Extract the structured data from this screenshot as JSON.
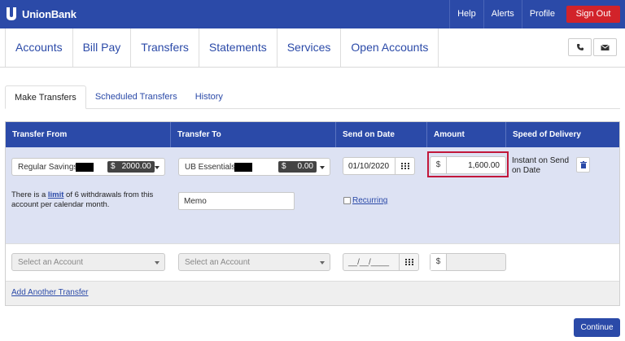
{
  "brand": {
    "name": "UnionBank"
  },
  "topnav": {
    "help": "Help",
    "alerts": "Alerts",
    "profile": "Profile",
    "signout": "Sign Out"
  },
  "mainnav": [
    "Accounts",
    "Bill Pay",
    "Transfers",
    "Statements",
    "Services",
    "Open Accounts"
  ],
  "tabs": [
    "Make Transfers",
    "Scheduled Transfers",
    "History"
  ],
  "table": {
    "headers": [
      "Transfer From",
      "Transfer To",
      "Send on Date",
      "Amount",
      "Speed of Delivery"
    ],
    "row1": {
      "from_account": "Regular Savings-",
      "from_currency": "$",
      "from_balance": "2000.00",
      "to_account": "UB Essentials -",
      "to_currency": "$",
      "to_balance": "0.00",
      "date": "01/10/2020",
      "amount_currency": "$",
      "amount": "1,600.00",
      "speed": "Instant on Send on Date",
      "limit_prefix": "There is a ",
      "limit_link": "limit",
      "limit_suffix": " of 6 withdrawals from this account per calendar month.",
      "memo": "Memo",
      "recurring": "Recurring"
    },
    "row2": {
      "from_placeholder": "Select an Account",
      "to_placeholder": "Select an Account",
      "date_placeholder": "__/__/____",
      "amount_currency": "$"
    }
  },
  "add_another": "Add Another Transfer",
  "continue": "Continue"
}
